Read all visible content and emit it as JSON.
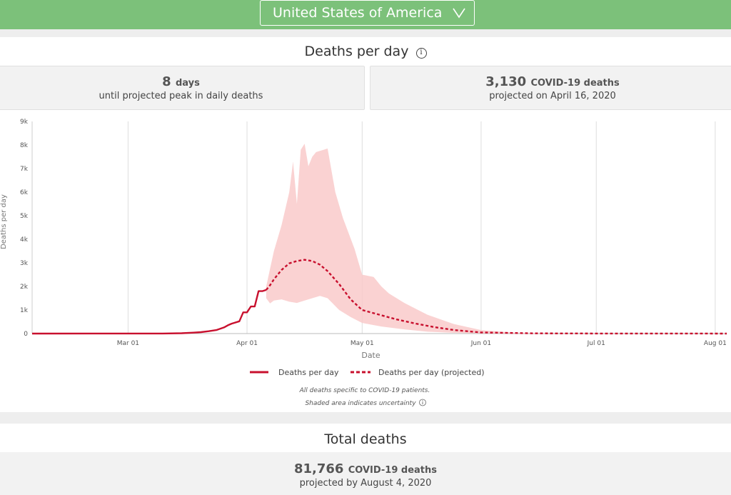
{
  "header": {
    "country": "United States of America",
    "chevron_icon": "chevron-down-icon"
  },
  "deaths_panel": {
    "title": "Deaths per day",
    "info_icon": "info-icon",
    "peak_stat": {
      "value": "8",
      "unit": "days",
      "caption": "until projected peak in daily deaths"
    },
    "deaths_stat": {
      "value": "3,130",
      "unit": "COVID-19 deaths",
      "caption": "projected on April 16, 2020"
    }
  },
  "chart_data": {
    "type": "line",
    "xlabel": "Date",
    "ylabel": "Deaths per day",
    "ylim": [
      0,
      9000
    ],
    "yticks": [
      0,
      1000,
      2000,
      3000,
      4000,
      5000,
      6000,
      7000,
      8000,
      9000
    ],
    "ytick_labels": [
      "0",
      "1k",
      "2k",
      "3k",
      "4k",
      "5k",
      "6k",
      "7k",
      "8k",
      "9k"
    ],
    "xlim": [
      "2020-02-05",
      "2020-08-04"
    ],
    "xticks": [
      "2020-03-01",
      "2020-04-01",
      "2020-05-01",
      "2020-06-01",
      "2020-07-01",
      "2020-08-01"
    ],
    "xtick_labels": [
      "Mar 01",
      "Apr 01",
      "May 01",
      "Jun 01",
      "Jul 01",
      "Aug 01"
    ],
    "grid": true,
    "series": [
      {
        "name": "Deaths per day",
        "style": "solid",
        "color": "#c8102e",
        "points": [
          [
            "2020-02-05",
            0
          ],
          [
            "2020-03-10",
            3
          ],
          [
            "2020-03-15",
            15
          ],
          [
            "2020-03-18",
            40
          ],
          [
            "2020-03-20",
            60
          ],
          [
            "2020-03-22",
            100
          ],
          [
            "2020-03-24",
            150
          ],
          [
            "2020-03-26",
            260
          ],
          [
            "2020-03-27",
            350
          ],
          [
            "2020-03-28",
            420
          ],
          [
            "2020-03-30",
            520
          ],
          [
            "2020-03-31",
            900
          ],
          [
            "2020-04-01",
            900
          ],
          [
            "2020-04-02",
            1150
          ],
          [
            "2020-04-03",
            1150
          ],
          [
            "2020-04-04",
            1800
          ],
          [
            "2020-04-05",
            1800
          ],
          [
            "2020-04-06",
            1850
          ]
        ]
      },
      {
        "name": "Deaths per day (projected)",
        "style": "dashed",
        "color": "#c8102e",
        "points": [
          [
            "2020-04-06",
            1850
          ],
          [
            "2020-04-07",
            2050
          ],
          [
            "2020-04-08",
            2300
          ],
          [
            "2020-04-10",
            2700
          ],
          [
            "2020-04-12",
            2980
          ],
          [
            "2020-04-14",
            3080
          ],
          [
            "2020-04-16",
            3130
          ],
          [
            "2020-04-18",
            3080
          ],
          [
            "2020-04-20",
            2920
          ],
          [
            "2020-04-22",
            2650
          ],
          [
            "2020-04-25",
            2100
          ],
          [
            "2020-04-28",
            1450
          ],
          [
            "2020-05-01",
            1000
          ],
          [
            "2020-05-05",
            820
          ],
          [
            "2020-05-10",
            600
          ],
          [
            "2020-05-15",
            420
          ],
          [
            "2020-05-20",
            270
          ],
          [
            "2020-05-25",
            150
          ],
          [
            "2020-06-01",
            50
          ],
          [
            "2020-06-15",
            10
          ],
          [
            "2020-07-01",
            3
          ],
          [
            "2020-08-04",
            0
          ]
        ]
      }
    ],
    "uncertainty_band": {
      "upper": [
        [
          "2020-04-06",
          2000
        ],
        [
          "2020-04-08",
          3500
        ],
        [
          "2020-04-10",
          4600
        ],
        [
          "2020-04-12",
          6000
        ],
        [
          "2020-04-13",
          7300
        ],
        [
          "2020-04-14",
          5500
        ],
        [
          "2020-04-15",
          7800
        ],
        [
          "2020-04-16",
          8050
        ],
        [
          "2020-04-17",
          7100
        ],
        [
          "2020-04-18",
          7500
        ],
        [
          "2020-04-19",
          7700
        ],
        [
          "2020-04-21",
          7800
        ],
        [
          "2020-04-22",
          7850
        ],
        [
          "2020-04-24",
          6000
        ],
        [
          "2020-04-26",
          4900
        ],
        [
          "2020-04-29",
          3600
        ],
        [
          "2020-05-01",
          2500
        ],
        [
          "2020-05-04",
          2400
        ],
        [
          "2020-05-06",
          2000
        ],
        [
          "2020-05-08",
          1700
        ],
        [
          "2020-05-12",
          1300
        ],
        [
          "2020-05-18",
          800
        ],
        [
          "2020-05-25",
          400
        ],
        [
          "2020-06-01",
          150
        ],
        [
          "2020-06-10",
          30
        ],
        [
          "2020-06-20",
          0
        ]
      ],
      "lower": [
        [
          "2020-06-20",
          0
        ],
        [
          "2020-06-01",
          5
        ],
        [
          "2020-05-25",
          30
        ],
        [
          "2020-05-18",
          80
        ],
        [
          "2020-05-12",
          180
        ],
        [
          "2020-05-06",
          300
        ],
        [
          "2020-05-01",
          450
        ],
        [
          "2020-04-28",
          700
        ],
        [
          "2020-04-25",
          1000
        ],
        [
          "2020-04-22",
          1500
        ],
        [
          "2020-04-20",
          1600
        ],
        [
          "2020-04-18",
          1500
        ],
        [
          "2020-04-16",
          1400
        ],
        [
          "2020-04-14",
          1300
        ],
        [
          "2020-04-12",
          1350
        ],
        [
          "2020-04-10",
          1450
        ],
        [
          "2020-04-08",
          1400
        ],
        [
          "2020-04-07",
          1280
        ],
        [
          "2020-04-06",
          1500
        ]
      ]
    },
    "legend": [
      "Deaths per day",
      "Deaths per day (projected)"
    ],
    "legend_placement": "bottom",
    "notes": [
      "All deaths specific to COVID-19 patients.",
      "Shaded area indicates uncertainty"
    ]
  },
  "total_panel": {
    "title": "Total deaths",
    "value": "81,766",
    "unit": "COVID-19 deaths",
    "caption": "projected by August 4, 2020"
  }
}
